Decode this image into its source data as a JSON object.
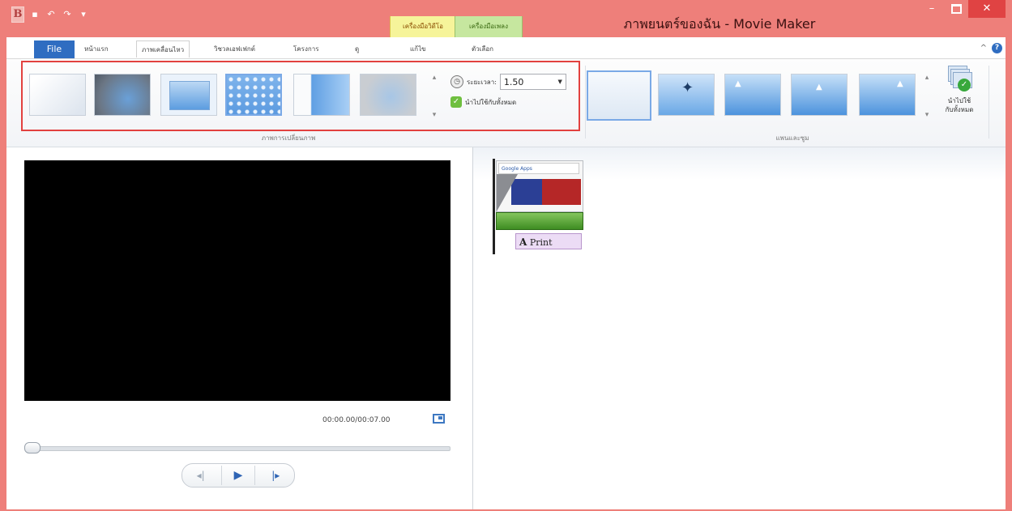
{
  "window": {
    "title": "ภาพยนตร์ของฉัน - Movie Maker",
    "contextual_tabs": [
      "เครื่องมือวิดีโอ",
      "เครื่องมือเพลง"
    ],
    "controls": {
      "minimize": "–",
      "close": "✕"
    }
  },
  "qat": {
    "app_icon": "B",
    "save": "▪",
    "undo": "↶",
    "redo": "↷",
    "customize": "▾"
  },
  "ribbon_tabs": {
    "file": "File",
    "items": [
      "หน้าแรก",
      "ภาพเคลื่อนไหว",
      "วิชวลเอฟเฟกต์",
      "โครงการ",
      "ดู",
      "แก้ไข",
      "ตัวเลือก"
    ],
    "active": "ภาพเคลื่อนไหว",
    "collapse": "^",
    "help": "?"
  },
  "transitions": {
    "group_label": "ภาพการเปลี่ยนภาพ",
    "selected_index": 3,
    "duration_label": "ระยะเวลา:",
    "duration_value": "1.50",
    "apply_all_label": "นำไปใช้กับทั้งหมด",
    "icons": [
      "clock-icon",
      "apply-all-icon"
    ]
  },
  "pan_zoom": {
    "group_label": "แพนและซูม",
    "apply_all_label_line1": "นำไปใช้",
    "apply_all_label_line2": "กับทั้งหมด"
  },
  "preview": {
    "time": "00:00.00/00:07.00",
    "progress_fraction": 0.0,
    "controls": {
      "prev": "◂|",
      "play": "▶",
      "next": "|▸"
    }
  },
  "storyboard": {
    "clip": {
      "banner_text": "Google Apps",
      "caption": "Print",
      "caption_icon": "A"
    }
  }
}
